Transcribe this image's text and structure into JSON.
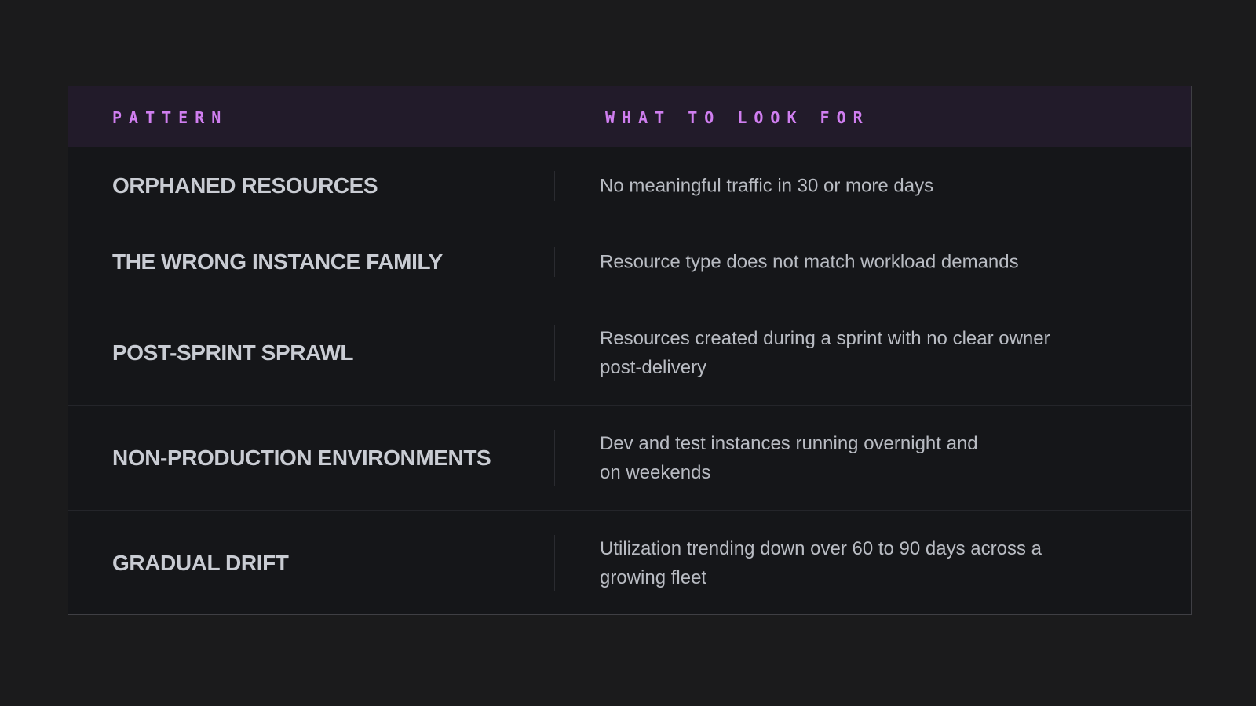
{
  "table": {
    "headers": {
      "pattern": "Pattern",
      "what_to_look_for": "What to look for"
    },
    "rows": [
      {
        "pattern": "ORPHANED RESOURCES",
        "description": "No meaningful traffic in 30 or more days"
      },
      {
        "pattern": "THE WRONG INSTANCE FAMILY",
        "description": "Resource type does not match workload demands"
      },
      {
        "pattern": "POST-SPRINT SPRAWL",
        "description": "Resources created during a sprint with no clear owner\npost-delivery"
      },
      {
        "pattern": "NON-PRODUCTION ENVIRONMENTS",
        "description": "Dev and test instances running overnight and\non weekends"
      },
      {
        "pattern": "GRADUAL DRIFT",
        "description": "Utilization trending down over 60 to 90 days across a\ngrowing fleet"
      }
    ]
  },
  "colors": {
    "background": "#1b1b1c",
    "table_background": "#151619",
    "header_background": "#221b2a",
    "header_text": "#d07ef0",
    "pattern_text": "#c9ccd3",
    "description_text": "#b9bcc3"
  }
}
